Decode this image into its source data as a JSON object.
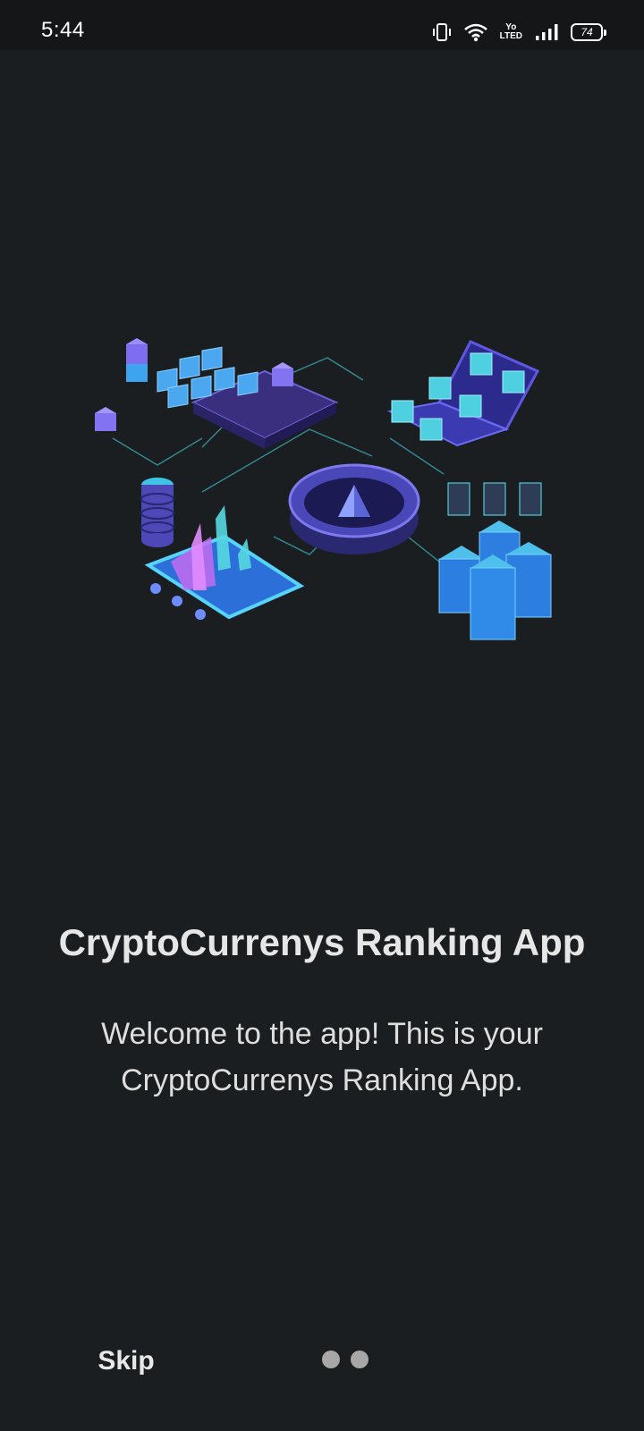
{
  "status_bar": {
    "time": "5:44",
    "battery_level": "74",
    "network_label_top": "Yo",
    "network_label_bottom": "LTED"
  },
  "onboarding": {
    "illustration": "crypto-blockchain-illustration",
    "title": "CryptoCurrenys Ranking App",
    "description": "Welcome to the app! This is your CryptoCurrenys Ranking App.",
    "skip_label": "Skip",
    "pages": 2
  },
  "colors": {
    "background": "#1b1e20",
    "status_bar": "#141618",
    "dot": "#a7a7a7",
    "accent_purple": "#6c5ce7",
    "accent_cyan": "#5ee6f0"
  }
}
